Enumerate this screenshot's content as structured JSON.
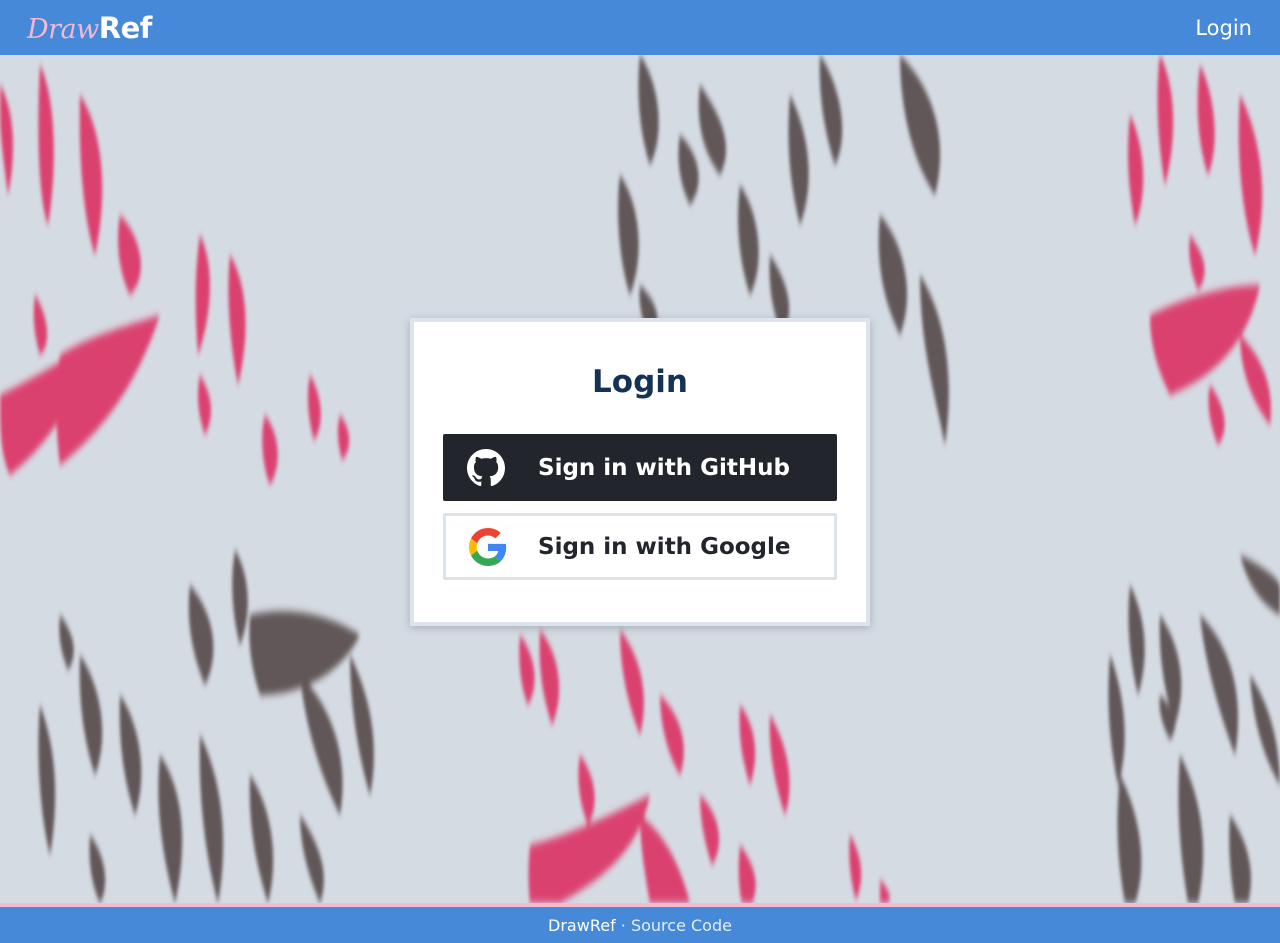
{
  "navbar": {
    "brand_first": "Draw",
    "brand_second": "Ref",
    "login_link": "Login"
  },
  "login_card": {
    "title": "Login",
    "github_label": "Sign in with GitHub",
    "google_label": "Sign in with Google"
  },
  "footer": {
    "brand_link": "DrawRef",
    "separator": " · ",
    "source_link": "Source Code"
  },
  "icons": {
    "github": "github-icon",
    "google": "google-icon"
  },
  "colors": {
    "navbar": "#4689d8",
    "brand_accent": "#f4b8d4",
    "background": "#d5dbe3",
    "github_button": "#22262c",
    "title": "#143256",
    "pink_splash": "#dc3466",
    "dark_splash": "#55484a"
  }
}
